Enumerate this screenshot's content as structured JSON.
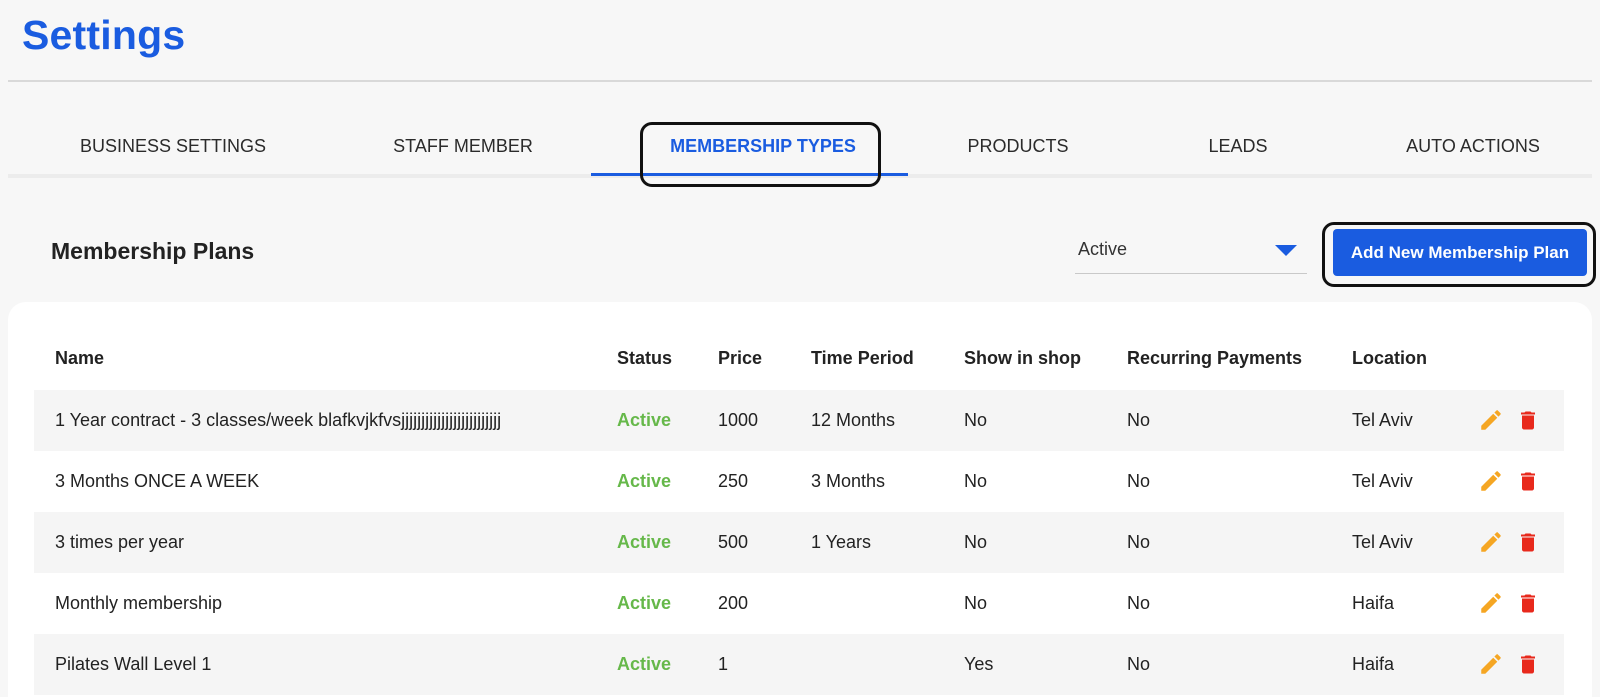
{
  "page": {
    "title": "Settings"
  },
  "tabs": [
    {
      "label": "BUSINESS SETTINGS",
      "active": false
    },
    {
      "label": "STAFF MEMBER",
      "active": false
    },
    {
      "label": "MEMBERSHIP TYPES",
      "active": true
    },
    {
      "label": "PRODUCTS",
      "active": false
    },
    {
      "label": "LEADS",
      "active": false
    },
    {
      "label": "AUTO ACTIONS",
      "active": false
    }
  ],
  "section": {
    "title": "Membership Plans",
    "status_filter": "Active",
    "add_button": "Add New Membership Plan"
  },
  "table": {
    "headers": {
      "name": "Name",
      "status": "Status",
      "price": "Price",
      "period": "Time Period",
      "shop": "Show in shop",
      "recurring": "Recurring Payments",
      "location": "Location"
    },
    "rows": [
      {
        "name": "1 Year contract - 3 classes/week blafkvjkfvsjjjjjjjjjjjjjjjjjjjjjjjjj",
        "status": "Active",
        "price": "1000",
        "period": "12 Months",
        "shop": "No",
        "recurring": "No",
        "location": "Tel Aviv"
      },
      {
        "name": "3 Months ONCE A WEEK",
        "status": "Active",
        "price": "250",
        "period": "3 Months",
        "shop": "No",
        "recurring": "No",
        "location": "Tel Aviv"
      },
      {
        "name": "3 times per year",
        "status": "Active",
        "price": "500",
        "period": "1 Years",
        "shop": "No",
        "recurring": "No",
        "location": "Tel Aviv"
      },
      {
        "name": "Monthly membership",
        "status": "Active",
        "price": "200",
        "period": "",
        "shop": "No",
        "recurring": "No",
        "location": "Haifa"
      },
      {
        "name": "Pilates Wall Level 1",
        "status": "Active",
        "price": "1",
        "period": "",
        "shop": "Yes",
        "recurring": "No",
        "location": "Haifa"
      }
    ]
  },
  "icons": {
    "edit": "pencil-icon",
    "delete": "trash-icon"
  },
  "colors": {
    "accent": "#1a5ce0",
    "status_active": "#66b84a",
    "edit_icon": "#f5a623",
    "delete_icon": "#e8291c"
  }
}
